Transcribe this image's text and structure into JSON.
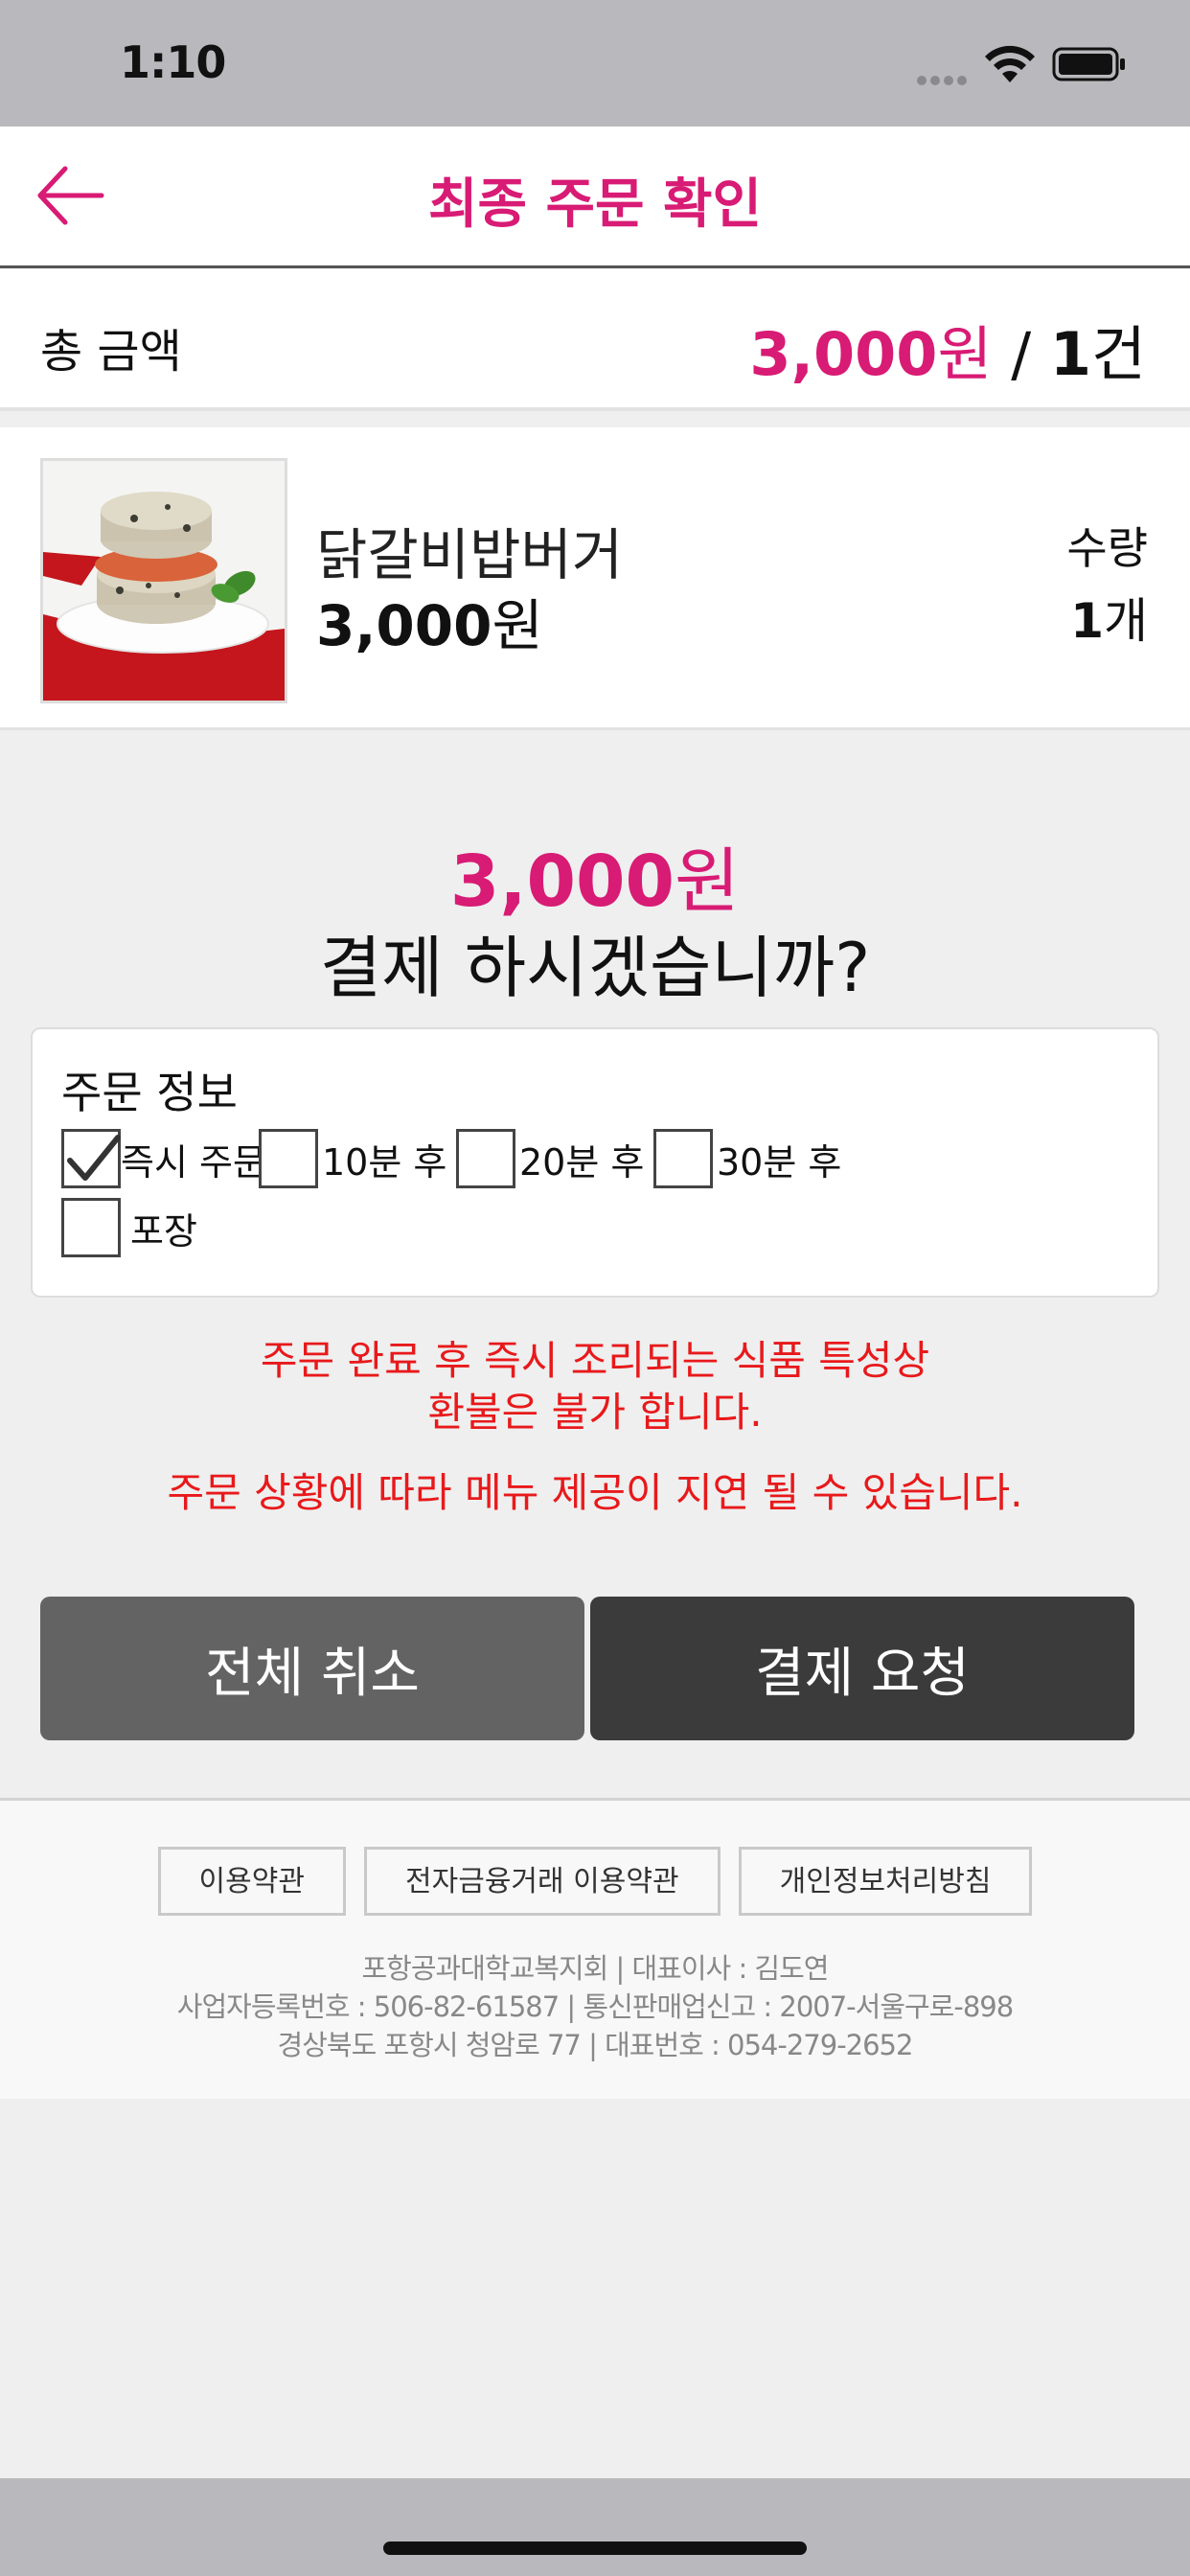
{
  "status_bar": {
    "time": "1:10"
  },
  "header": {
    "title": "최종 주문 확인"
  },
  "total": {
    "label": "총 금액",
    "amount": "3,000",
    "amount_unit": "원",
    "separator": " / ",
    "count": "1",
    "count_unit": "건"
  },
  "item": {
    "name": "닭갈비밥버거",
    "price": "3,000",
    "price_unit": "원",
    "qty_label": "수량",
    "qty": "1",
    "qty_unit": "개"
  },
  "confirm": {
    "amount": "3,000",
    "amount_unit": "원",
    "question": "결제 하시겠습니까?"
  },
  "order_info": {
    "title": "주문 정보",
    "options": [
      {
        "label": "즉시 주문",
        "checked": true
      },
      {
        "label": "10분 후",
        "checked": false
      },
      {
        "label": "20분 후",
        "checked": false
      },
      {
        "label": "30분 후",
        "checked": false
      },
      {
        "label": "포장",
        "checked": false
      }
    ]
  },
  "notices": {
    "line1": "주문 완료 후 즉시 조리되는 식품 특성상",
    "line2": "환불은 불가 합니다.",
    "line3": "주문 상황에 따라 메뉴 제공이 지연 될 수 있습니다."
  },
  "buttons": {
    "cancel": "전체 취소",
    "pay": "결제 요청"
  },
  "footer": {
    "links": [
      "이용약관",
      "전자금융거래 이용약관",
      "개인정보처리방침"
    ],
    "line1": "포항공과대학교복지회  |  대표이사 : 김도연",
    "line2": "사업자등록번호 : 506-82-61587  |  통신판매업신고 : 2007-서울구로-898",
    "line3": "경상북도 포항시 청암로 77  |  대표번호 : 054-279-2652"
  },
  "colors": {
    "accent": "#d81b74",
    "notice": "#e8191b",
    "cancel_btn": "#636363",
    "pay_btn": "#3b3b3b"
  }
}
